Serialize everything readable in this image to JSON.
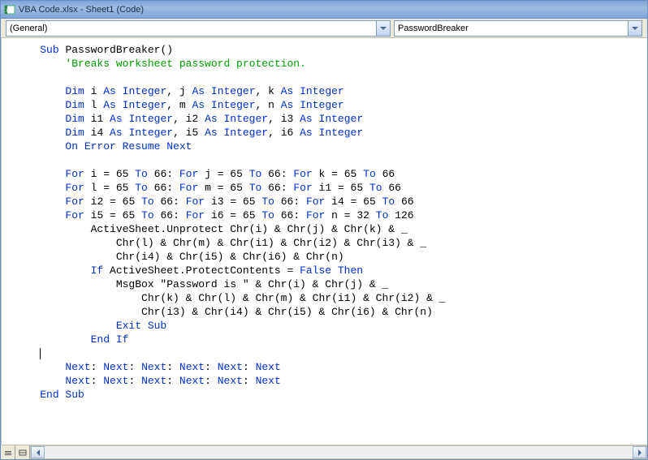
{
  "window": {
    "title": "VBA Code.xlsx - Sheet1 (Code)"
  },
  "dropdowns": {
    "general_label": "(General)",
    "procedure_label": "PasswordBreaker"
  },
  "code": {
    "lines": [
      {
        "ind": 1,
        "parts": [
          {
            "t": "Sub ",
            "c": "kw"
          },
          {
            "t": "PasswordBreaker()",
            "c": ""
          }
        ]
      },
      {
        "ind": 2,
        "parts": [
          {
            "t": "'Breaks worksheet password protection.",
            "c": "cm"
          }
        ]
      },
      {
        "ind": 0,
        "parts": [
          {
            "t": "",
            "c": ""
          }
        ]
      },
      {
        "ind": 2,
        "parts": [
          {
            "t": "Dim ",
            "c": "kw"
          },
          {
            "t": "i ",
            "c": ""
          },
          {
            "t": "As Integer",
            "c": "kw"
          },
          {
            "t": ", j ",
            "c": ""
          },
          {
            "t": "As Integer",
            "c": "kw"
          },
          {
            "t": ", k ",
            "c": ""
          },
          {
            "t": "As Integer",
            "c": "kw"
          }
        ]
      },
      {
        "ind": 2,
        "parts": [
          {
            "t": "Dim ",
            "c": "kw"
          },
          {
            "t": "l ",
            "c": ""
          },
          {
            "t": "As Integer",
            "c": "kw"
          },
          {
            "t": ", m ",
            "c": ""
          },
          {
            "t": "As Integer",
            "c": "kw"
          },
          {
            "t": ", n ",
            "c": ""
          },
          {
            "t": "As Integer",
            "c": "kw"
          }
        ]
      },
      {
        "ind": 2,
        "parts": [
          {
            "t": "Dim ",
            "c": "kw"
          },
          {
            "t": "i1 ",
            "c": ""
          },
          {
            "t": "As Integer",
            "c": "kw"
          },
          {
            "t": ", i2 ",
            "c": ""
          },
          {
            "t": "As Integer",
            "c": "kw"
          },
          {
            "t": ", i3 ",
            "c": ""
          },
          {
            "t": "As Integer",
            "c": "kw"
          }
        ]
      },
      {
        "ind": 2,
        "parts": [
          {
            "t": "Dim ",
            "c": "kw"
          },
          {
            "t": "i4 ",
            "c": ""
          },
          {
            "t": "As Integer",
            "c": "kw"
          },
          {
            "t": ", i5 ",
            "c": ""
          },
          {
            "t": "As Integer",
            "c": "kw"
          },
          {
            "t": ", i6 ",
            "c": ""
          },
          {
            "t": "As Integer",
            "c": "kw"
          }
        ]
      },
      {
        "ind": 2,
        "parts": [
          {
            "t": "On Error Resume Next",
            "c": "kw"
          }
        ]
      },
      {
        "ind": 0,
        "parts": [
          {
            "t": "",
            "c": ""
          }
        ]
      },
      {
        "ind": 2,
        "parts": [
          {
            "t": "For ",
            "c": "kw"
          },
          {
            "t": "i = 65 ",
            "c": ""
          },
          {
            "t": "To ",
            "c": "kw"
          },
          {
            "t": "66: ",
            "c": ""
          },
          {
            "t": "For ",
            "c": "kw"
          },
          {
            "t": "j = 65 ",
            "c": ""
          },
          {
            "t": "To ",
            "c": "kw"
          },
          {
            "t": "66: ",
            "c": ""
          },
          {
            "t": "For ",
            "c": "kw"
          },
          {
            "t": "k = 65 ",
            "c": ""
          },
          {
            "t": "To ",
            "c": "kw"
          },
          {
            "t": "66",
            "c": ""
          }
        ]
      },
      {
        "ind": 2,
        "parts": [
          {
            "t": "For ",
            "c": "kw"
          },
          {
            "t": "l = 65 ",
            "c": ""
          },
          {
            "t": "To ",
            "c": "kw"
          },
          {
            "t": "66: ",
            "c": ""
          },
          {
            "t": "For ",
            "c": "kw"
          },
          {
            "t": "m = 65 ",
            "c": ""
          },
          {
            "t": "To ",
            "c": "kw"
          },
          {
            "t": "66: ",
            "c": ""
          },
          {
            "t": "For ",
            "c": "kw"
          },
          {
            "t": "i1 = 65 ",
            "c": ""
          },
          {
            "t": "To ",
            "c": "kw"
          },
          {
            "t": "66",
            "c": ""
          }
        ]
      },
      {
        "ind": 2,
        "parts": [
          {
            "t": "For ",
            "c": "kw"
          },
          {
            "t": "i2 = 65 ",
            "c": ""
          },
          {
            "t": "To ",
            "c": "kw"
          },
          {
            "t": "66: ",
            "c": ""
          },
          {
            "t": "For ",
            "c": "kw"
          },
          {
            "t": "i3 = 65 ",
            "c": ""
          },
          {
            "t": "To ",
            "c": "kw"
          },
          {
            "t": "66: ",
            "c": ""
          },
          {
            "t": "For ",
            "c": "kw"
          },
          {
            "t": "i4 = 65 ",
            "c": ""
          },
          {
            "t": "To ",
            "c": "kw"
          },
          {
            "t": "66",
            "c": ""
          }
        ]
      },
      {
        "ind": 2,
        "parts": [
          {
            "t": "For ",
            "c": "kw"
          },
          {
            "t": "i5 = 65 ",
            "c": ""
          },
          {
            "t": "To ",
            "c": "kw"
          },
          {
            "t": "66: ",
            "c": ""
          },
          {
            "t": "For ",
            "c": "kw"
          },
          {
            "t": "i6 = 65 ",
            "c": ""
          },
          {
            "t": "To ",
            "c": "kw"
          },
          {
            "t": "66: ",
            "c": ""
          },
          {
            "t": "For ",
            "c": "kw"
          },
          {
            "t": "n = 32 ",
            "c": ""
          },
          {
            "t": "To ",
            "c": "kw"
          },
          {
            "t": "126",
            "c": ""
          }
        ]
      },
      {
        "ind": 3,
        "parts": [
          {
            "t": "ActiveSheet.Unprotect Chr(i) & Chr(j) & Chr(k) & _",
            "c": ""
          }
        ]
      },
      {
        "ind": 4,
        "parts": [
          {
            "t": "Chr(l) & Chr(m) & Chr(i1) & Chr(i2) & Chr(i3) & _",
            "c": ""
          }
        ]
      },
      {
        "ind": 4,
        "parts": [
          {
            "t": "Chr(i4) & Chr(i5) & Chr(i6) & Chr(n)",
            "c": ""
          }
        ]
      },
      {
        "ind": 3,
        "parts": [
          {
            "t": "If ",
            "c": "kw"
          },
          {
            "t": "ActiveSheet.ProtectContents = ",
            "c": ""
          },
          {
            "t": "False Then",
            "c": "kw"
          }
        ]
      },
      {
        "ind": 4,
        "parts": [
          {
            "t": "MsgBox \"Password is \" & Chr(i) & Chr(j) & _",
            "c": ""
          }
        ]
      },
      {
        "ind": 5,
        "parts": [
          {
            "t": "Chr(k) & Chr(l) & Chr(m) & Chr(i1) & Chr(i2) & _",
            "c": ""
          }
        ]
      },
      {
        "ind": 5,
        "parts": [
          {
            "t": "Chr(i3) & Chr(i4) & Chr(i5) & Chr(i6) & Chr(n)",
            "c": ""
          }
        ]
      },
      {
        "ind": 4,
        "parts": [
          {
            "t": "Exit Sub",
            "c": "kw"
          }
        ]
      },
      {
        "ind": 3,
        "parts": [
          {
            "t": "End If",
            "c": "kw"
          }
        ]
      },
      {
        "ind": 1,
        "parts": [
          {
            "t": "|",
            "c": "cursor"
          }
        ]
      },
      {
        "ind": 2,
        "parts": [
          {
            "t": "Next",
            "c": "kw"
          },
          {
            "t": ": ",
            "c": ""
          },
          {
            "t": "Next",
            "c": "kw"
          },
          {
            "t": ": ",
            "c": ""
          },
          {
            "t": "Next",
            "c": "kw"
          },
          {
            "t": ": ",
            "c": ""
          },
          {
            "t": "Next",
            "c": "kw"
          },
          {
            "t": ": ",
            "c": ""
          },
          {
            "t": "Next",
            "c": "kw"
          },
          {
            "t": ": ",
            "c": ""
          },
          {
            "t": "Next",
            "c": "kw"
          }
        ]
      },
      {
        "ind": 2,
        "parts": [
          {
            "t": "Next",
            "c": "kw"
          },
          {
            "t": ": ",
            "c": ""
          },
          {
            "t": "Next",
            "c": "kw"
          },
          {
            "t": ": ",
            "c": ""
          },
          {
            "t": "Next",
            "c": "kw"
          },
          {
            "t": ": ",
            "c": ""
          },
          {
            "t": "Next",
            "c": "kw"
          },
          {
            "t": ": ",
            "c": ""
          },
          {
            "t": "Next",
            "c": "kw"
          },
          {
            "t": ": ",
            "c": ""
          },
          {
            "t": "Next",
            "c": "kw"
          }
        ]
      },
      {
        "ind": 1,
        "parts": [
          {
            "t": "End Sub",
            "c": "kw"
          }
        ]
      }
    ]
  }
}
